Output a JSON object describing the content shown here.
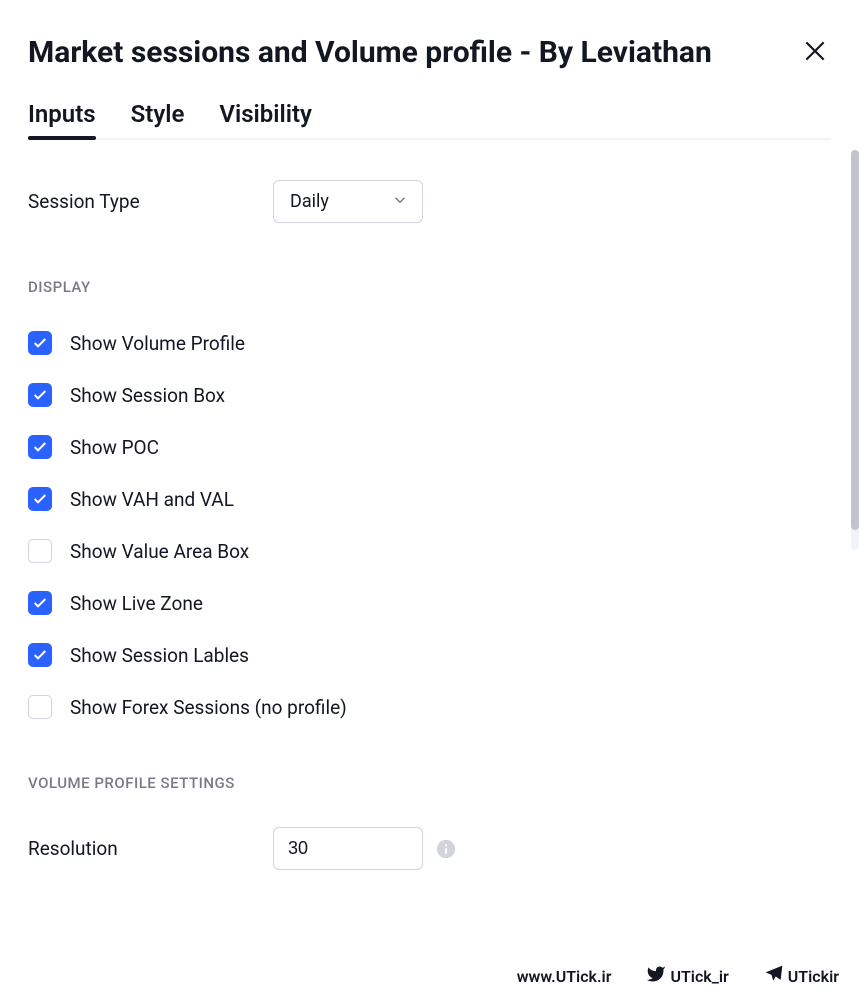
{
  "title": "Market sessions and Volume profile - By Leviathan",
  "tabs": [
    {
      "label": "Inputs",
      "active": true
    },
    {
      "label": "Style",
      "active": false
    },
    {
      "label": "Visibility",
      "active": false
    }
  ],
  "session_type": {
    "label": "Session Type",
    "value": "Daily"
  },
  "sections": {
    "display": {
      "header": "DISPLAY",
      "items": [
        {
          "label": "Show Volume Profile",
          "checked": true
        },
        {
          "label": "Show Session Box",
          "checked": true
        },
        {
          "label": "Show POC",
          "checked": true
        },
        {
          "label": "Show VAH and VAL",
          "checked": true
        },
        {
          "label": "Show Value Area Box",
          "checked": false
        },
        {
          "label": "Show Live Zone",
          "checked": true
        },
        {
          "label": "Show Session Lables",
          "checked": true
        },
        {
          "label": "Show Forex Sessions (no profile)",
          "checked": false
        }
      ]
    },
    "volume_profile": {
      "header": "VOLUME PROFILE SETTINGS",
      "resolution": {
        "label": "Resolution",
        "value": "30"
      }
    }
  },
  "footer": {
    "website": "www.UTick.ir",
    "twitter": "UTick_ir",
    "telegram": "UTickir"
  }
}
